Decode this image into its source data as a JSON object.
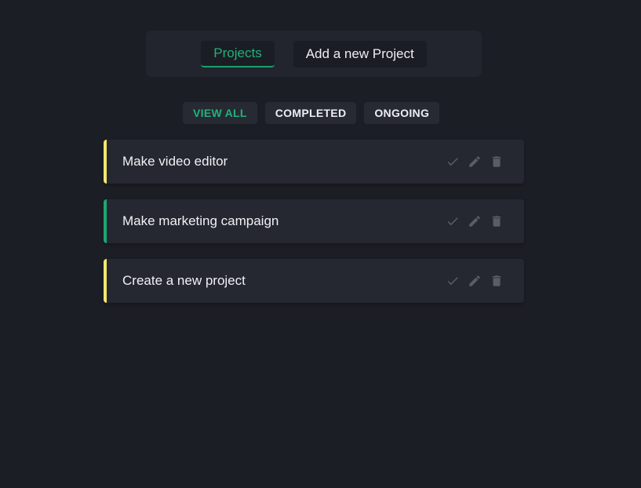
{
  "nav": {
    "tabs": [
      {
        "label": "Projects",
        "active": true
      },
      {
        "label": "Add a new Project",
        "active": false
      }
    ]
  },
  "filters": [
    {
      "label": "VIEW ALL",
      "active": true
    },
    {
      "label": "COMPLETED",
      "active": false
    },
    {
      "label": "ONGOING",
      "active": false
    }
  ],
  "projects": [
    {
      "title": "Make video editor",
      "status": "ongoing"
    },
    {
      "title": "Make marketing campaign",
      "status": "completed"
    },
    {
      "title": "Create a new project",
      "status": "ongoing"
    }
  ],
  "icons": {
    "complete": "check-icon",
    "edit": "pencil-icon",
    "delete": "trash-icon"
  },
  "colors": {
    "accent": "#21b27a",
    "ongoing": "#f4e86b",
    "completed": "#1aa872",
    "background": "#1c1e25"
  }
}
